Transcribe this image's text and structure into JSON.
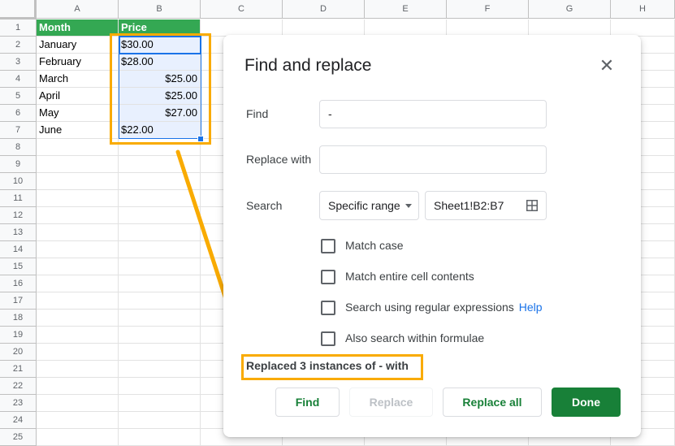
{
  "spreadsheet": {
    "columns": [
      "A",
      "B",
      "C",
      "D",
      "E",
      "F",
      "G",
      "H"
    ],
    "rows": [
      "1",
      "2",
      "3",
      "4",
      "5",
      "6",
      "7",
      "8",
      "9",
      "10",
      "11",
      "12",
      "13",
      "14",
      "15",
      "16",
      "17",
      "18",
      "19",
      "20",
      "21",
      "22",
      "23",
      "24",
      "25"
    ],
    "header_row": {
      "A": "Month",
      "B": "Price"
    },
    "data": [
      {
        "month": "January",
        "price": "$30.00"
      },
      {
        "month": "February",
        "price": "$28.00"
      },
      {
        "month": "March",
        "price": "$25.00"
      },
      {
        "month": "April",
        "price": "$25.00"
      },
      {
        "month": "May",
        "price": "$27.00"
      },
      {
        "month": "June",
        "price": "$22.00"
      }
    ],
    "header_color": "#34a853",
    "selection_color": "#1a73e8",
    "selected_range": "B2:B7"
  },
  "annotation": {
    "color": "#f9ab00"
  },
  "dialog": {
    "title": "Find and replace",
    "close_icon": "close-icon",
    "find_label": "Find",
    "find_value": "-",
    "replace_label": "Replace with",
    "replace_value": "",
    "search_label": "Search",
    "search_scope": "Specific range",
    "range_value": "Sheet1!B2:B7",
    "range_icon": "grid-select-icon",
    "options": [
      {
        "label": "Match case",
        "checked": false
      },
      {
        "label": "Match entire cell contents",
        "checked": false
      },
      {
        "label": "Search using regular expressions",
        "checked": false,
        "link": "Help"
      },
      {
        "label": "Also search within formulae",
        "checked": false
      }
    ],
    "status": "Replaced 3 instances of - with",
    "buttons": {
      "find": "Find",
      "replace": "Replace",
      "replace_all": "Replace all",
      "done": "Done"
    },
    "accent": "#188038"
  }
}
